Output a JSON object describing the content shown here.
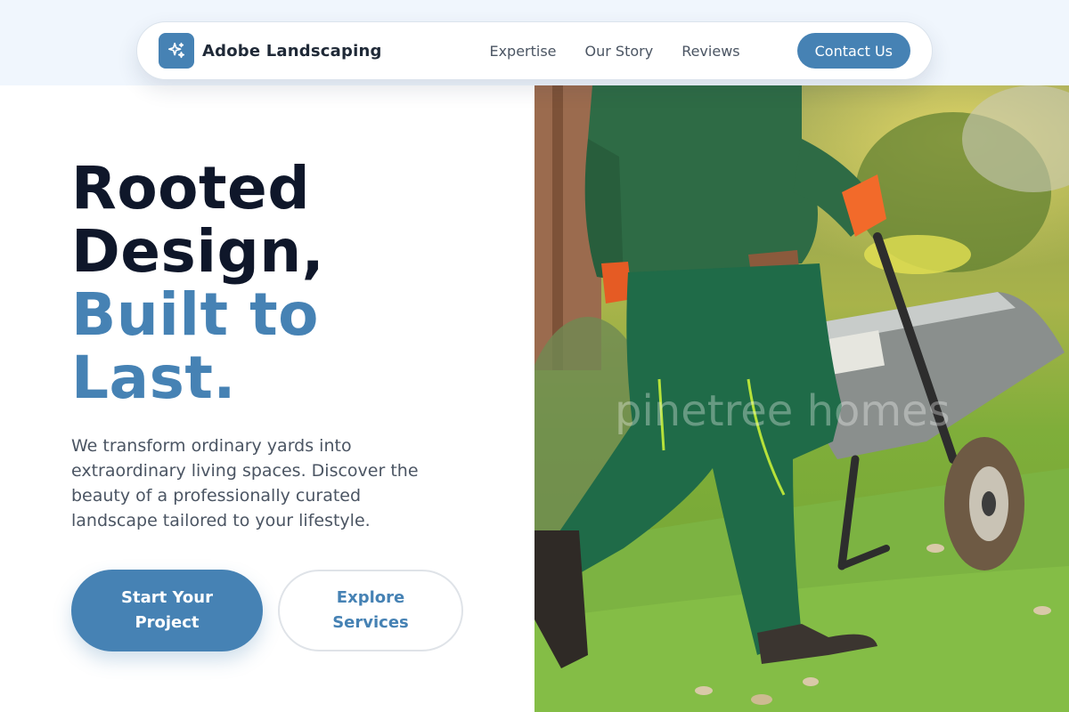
{
  "brand": {
    "name": "Adobe Landscaping",
    "logo_icon": "sparkles-icon"
  },
  "nav": {
    "links": [
      "Expertise",
      "Our Story",
      "Reviews"
    ],
    "contact_label": "Contact Us"
  },
  "hero": {
    "headline_line1": "Rooted",
    "headline_line2": "Design,",
    "headline_accent_line1": "Built to",
    "headline_accent_line2": "Last.",
    "lead": "We transform ordinary yards into extraordinary living spaces. Discover the beauty of a professionally curated landscape tailored to your lifestyle.",
    "primary_cta": "Start Your Project",
    "secondary_cta": "Explore Services",
    "photo_watermark": "pinetree homes"
  },
  "colors": {
    "accent": "#4682b4",
    "heading": "#0f172a",
    "body_text": "#4b5563",
    "top_band": "#f0f6fd"
  }
}
